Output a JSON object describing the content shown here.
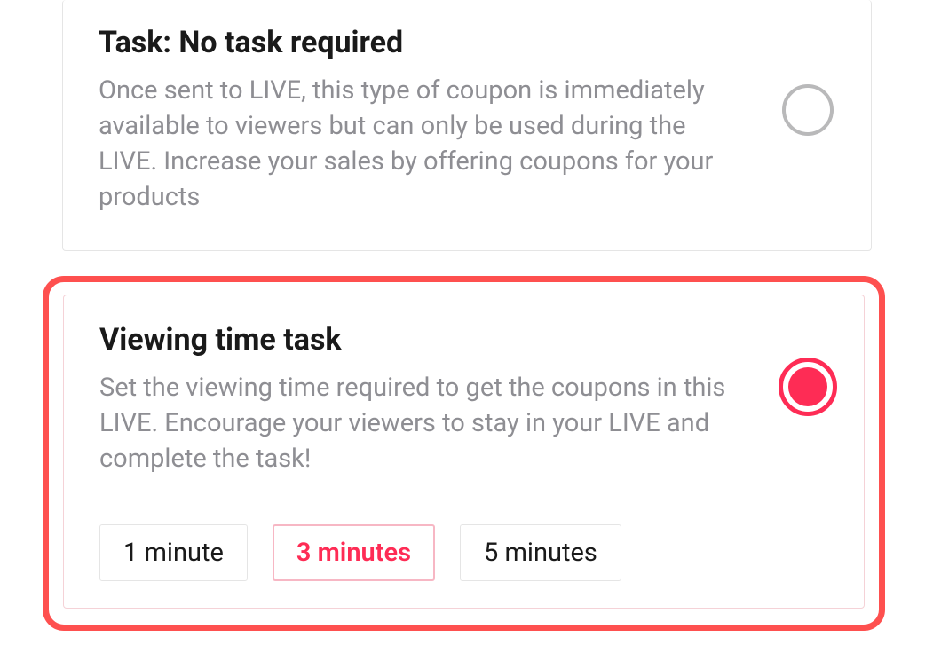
{
  "tasks": [
    {
      "title": "Task: No task required",
      "description": "Once sent to LIVE, this type of coupon is immediately available to viewers but can only be used during the LIVE. Increase your sales by offering coupons for your products",
      "selected": false
    },
    {
      "title": "Viewing time task",
      "description": "Set the viewing time required to get the coupons in this LIVE. Encourage your viewers to stay in your LIVE and complete the task!",
      "selected": true,
      "options": [
        {
          "label": "1 minute",
          "selected": false
        },
        {
          "label": "3 minutes",
          "selected": true
        },
        {
          "label": "5 minutes",
          "selected": false
        }
      ]
    }
  ]
}
